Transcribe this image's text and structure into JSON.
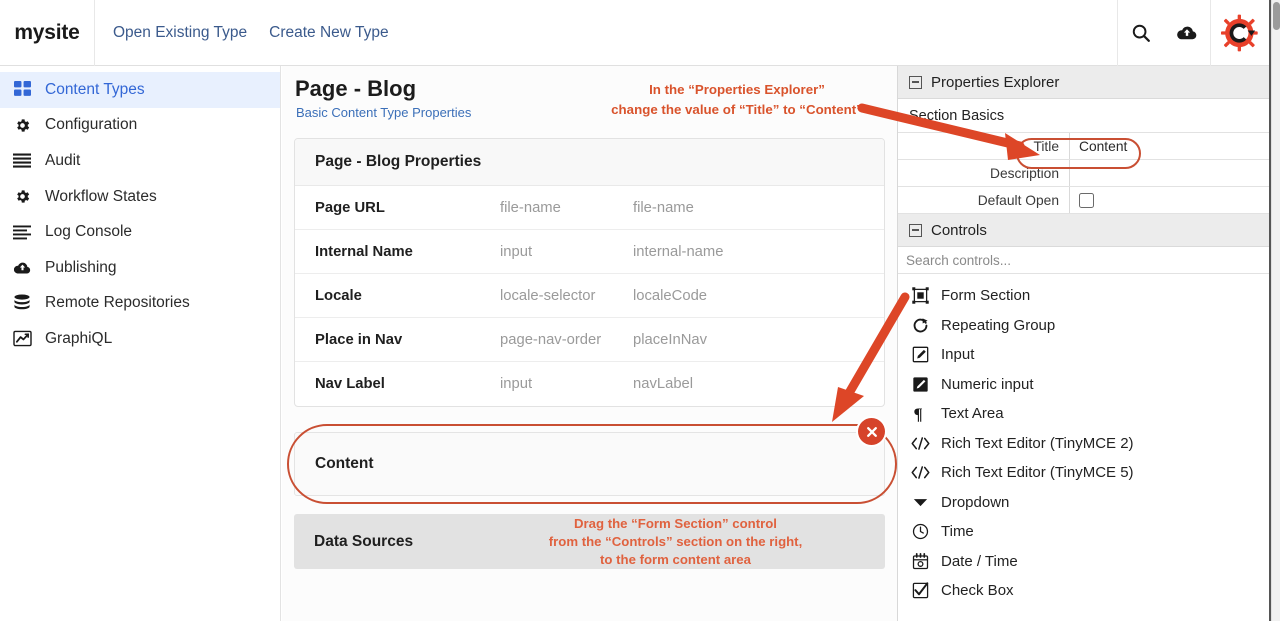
{
  "topbar": {
    "brand": "mysite",
    "nav": [
      {
        "label": "Open Existing Type"
      },
      {
        "label": "Create New Type"
      }
    ],
    "actions": [
      {
        "name": "search-icon",
        "label": "Search"
      },
      {
        "name": "cloud-upload-icon",
        "label": "Publish"
      },
      {
        "name": "crafter-logo",
        "label": "Crafter CMS"
      }
    ]
  },
  "sidebar": {
    "items": [
      {
        "label": "Content Types",
        "icon": "grid-icon",
        "active": true
      },
      {
        "label": "Configuration",
        "icon": "gear-icon",
        "active": false
      },
      {
        "label": "Audit",
        "icon": "list-icon",
        "active": false
      },
      {
        "label": "Workflow States",
        "icon": "gear-icon",
        "active": false
      },
      {
        "label": "Log Console",
        "icon": "list-icon",
        "active": false
      },
      {
        "label": "Publishing",
        "icon": "cloud-icon",
        "active": false
      },
      {
        "label": "Remote Repositories",
        "icon": "database-icon",
        "active": false
      },
      {
        "label": "GraphiQL",
        "icon": "chart-line-icon",
        "active": false
      }
    ]
  },
  "main": {
    "title": "Page - Blog",
    "subtitle": "Basic Content Type Properties",
    "annotation_top": "In the “Properties Explorer” change the value of “Title” to “Content”",
    "annotation_top_line1": "In the “Properties Explorer”",
    "annotation_top_line2": "change the value of “Title” to “Content”",
    "properties_card": {
      "header": "Page - Blog Properties",
      "rows": [
        {
          "label": "Page URL",
          "control": "file-name",
          "field": "file-name"
        },
        {
          "label": "Internal Name",
          "control": "input",
          "field": "internal-name"
        },
        {
          "label": "Locale",
          "control": "locale-selector",
          "field": "localeCode"
        },
        {
          "label": "Place in Nav",
          "control": "page-nav-order",
          "field": "placeInNav"
        },
        {
          "label": "Nav Label",
          "control": "input",
          "field": "navLabel"
        }
      ]
    },
    "content_section": {
      "label": "Content",
      "close_icon": "close-icon",
      "highlighted": true
    },
    "data_sources": {
      "label": "Data Sources",
      "annotation_line1": "Drag the “Form Section” control",
      "annotation_line2": "from the “Controls” section on the right,",
      "annotation_line3": "to the form content area"
    }
  },
  "right_panel": {
    "properties_explorer": {
      "title": "Properties Explorer",
      "group": "Section Basics",
      "rows": [
        {
          "label": "Title",
          "value": "Content",
          "type": "text",
          "highlighted": true
        },
        {
          "label": "Description",
          "value": "",
          "type": "text",
          "highlighted": false
        },
        {
          "label": "Default Open",
          "value": "",
          "type": "checkbox",
          "checked": false,
          "highlighted": false
        }
      ]
    },
    "controls": {
      "title": "Controls",
      "search_placeholder": "Search controls...",
      "items": [
        {
          "label": "Form Section",
          "icon": "form-section-icon"
        },
        {
          "label": "Repeating Group",
          "icon": "repeat-icon"
        },
        {
          "label": "Input",
          "icon": "input-pencil-icon"
        },
        {
          "label": "Numeric input",
          "icon": "numeric-pencil-icon"
        },
        {
          "label": "Text Area",
          "icon": "pilcrow-icon"
        },
        {
          "label": "Rich Text Editor (TinyMCE 2)",
          "icon": "code-icon"
        },
        {
          "label": "Rich Text Editor (TinyMCE 5)",
          "icon": "code-icon"
        },
        {
          "label": "Dropdown",
          "icon": "chevron-down-icon"
        },
        {
          "label": "Time",
          "icon": "clock-icon"
        },
        {
          "label": "Date / Time",
          "icon": "calendar-icon"
        },
        {
          "label": "Check Box",
          "icon": "checkbox-icon"
        }
      ]
    }
  },
  "colors": {
    "annotation_red": "#d9532c",
    "highlight_outline": "#c94f33",
    "brand_red": "#e8402a",
    "accent_blue": "#3367d6",
    "link_blue": "#3b5a8c"
  }
}
